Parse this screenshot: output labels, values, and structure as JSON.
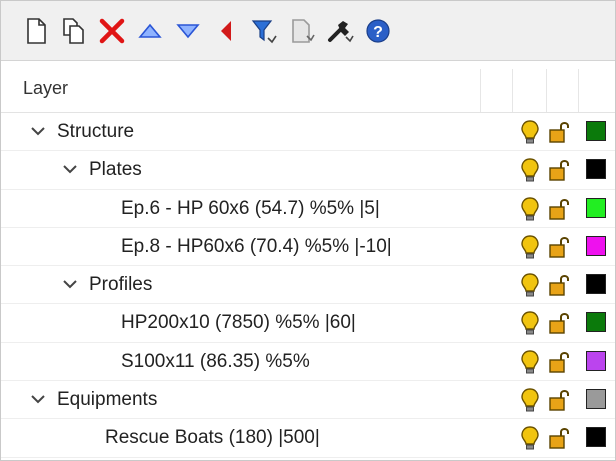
{
  "toolbar": {
    "buttons": [
      {
        "icon": "new-layer-icon"
      },
      {
        "icon": "new-sublayer-icon"
      },
      {
        "icon": "delete-icon"
      },
      {
        "icon": "move-up-icon"
      },
      {
        "icon": "move-down-icon"
      },
      {
        "icon": "move-to-parent-icon"
      },
      {
        "icon": "filter-icon"
      },
      {
        "icon": "copy-layer-icon"
      },
      {
        "icon": "tools-icon"
      },
      {
        "icon": "help-icon"
      }
    ]
  },
  "header": {
    "title": "Layer"
  },
  "rows": [
    {
      "label": "Structure",
      "level": 0,
      "expanded": true,
      "color": "#0b7a0b"
    },
    {
      "label": "Plates",
      "level": 1,
      "expanded": true,
      "color": "#000000"
    },
    {
      "label": "Ep.6 - HP 60x6 (54.7) %5% |5|",
      "level": 2,
      "color": "#22ee22"
    },
    {
      "label": "Ep.8 - HP60x6 (70.4) %5% |-10|",
      "level": 2,
      "color": "#ee11ee"
    },
    {
      "label": "Profiles",
      "level": 1,
      "expanded": true,
      "color": "#000000"
    },
    {
      "label": "HP200x10 (7850) %5% |60|",
      "level": 2,
      "color": "#0b7a0b"
    },
    {
      "label": "S100x11 (86.35) %5%",
      "level": 2,
      "color": "#bb44ee"
    },
    {
      "label": "Equipments",
      "level": 0,
      "expanded": true,
      "color": "#9a9a9a"
    },
    {
      "label": "Rescue Boats (180) |500|",
      "level": 1.5,
      "color": "#000000"
    }
  ],
  "colors": {
    "bulb": "#f1c40f",
    "lock": "#e8a317"
  }
}
